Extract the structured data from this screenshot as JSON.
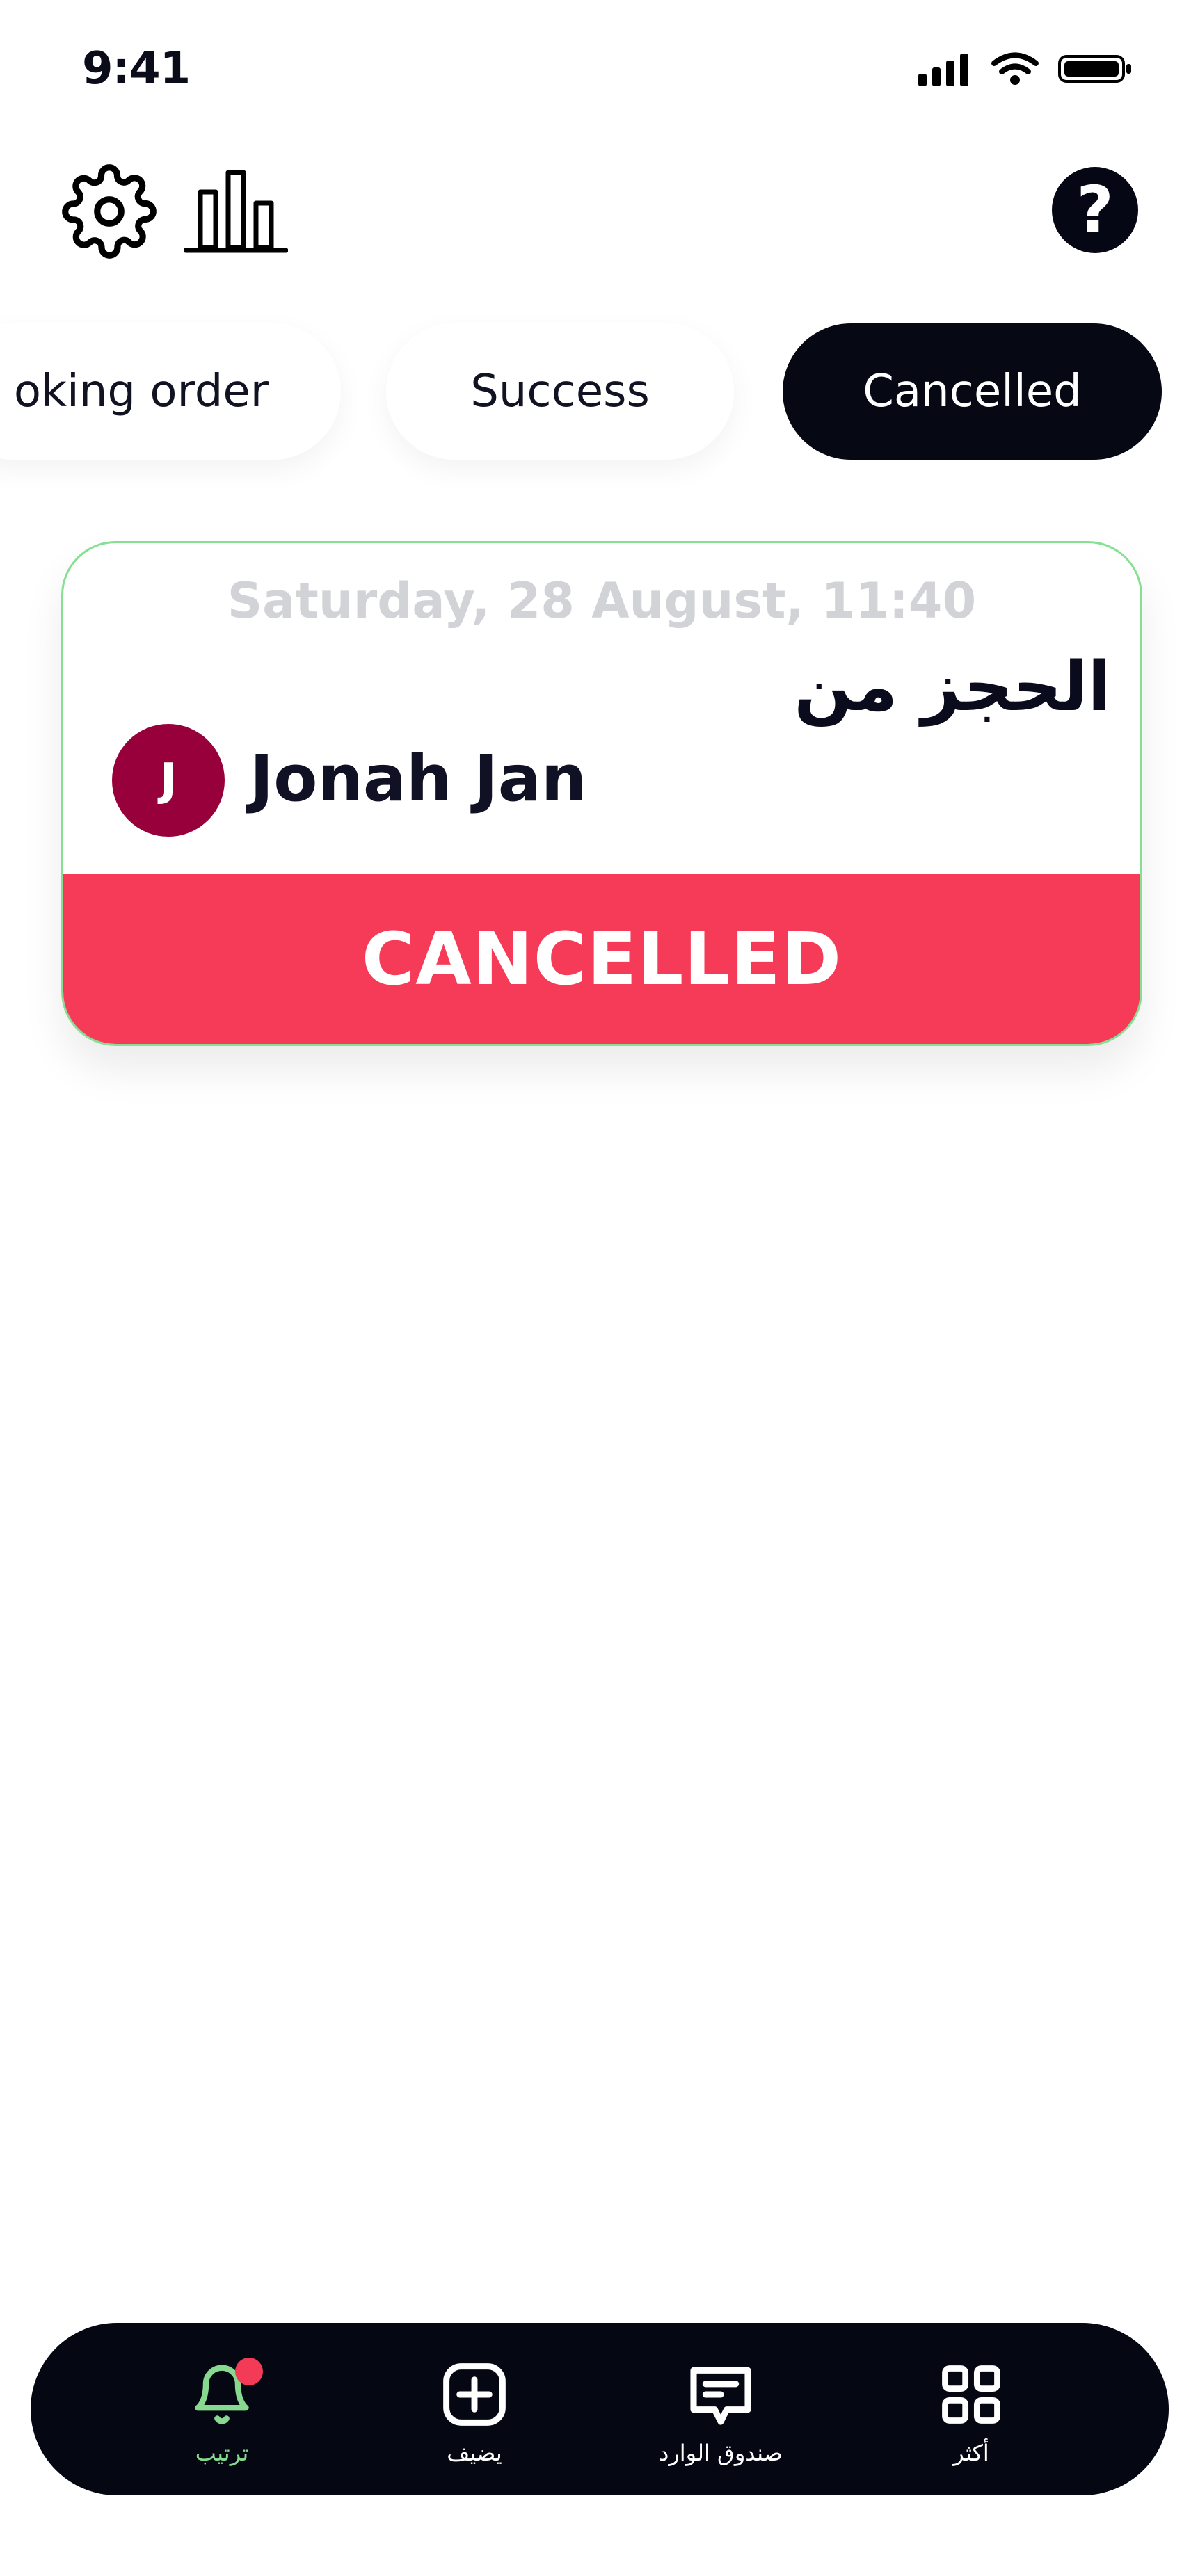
{
  "status_bar": {
    "time": "9:41"
  },
  "header": {
    "help_symbol": "?"
  },
  "tabs": [
    {
      "label": "oking order",
      "active": false
    },
    {
      "label": "Success",
      "active": false
    },
    {
      "label": "Cancelled",
      "active": true
    }
  ],
  "booking": {
    "date": "Saturday, 28 August, 11:40",
    "title": "الحجز من",
    "customer": {
      "initial": "J",
      "name": "Jonah Jan"
    },
    "status": "CANCELLED"
  },
  "bottom_nav": {
    "items": [
      {
        "label": "ترتيب",
        "icon": "bell-icon",
        "active": true,
        "has_notification": true
      },
      {
        "label": "يضيف",
        "icon": "plus-square-icon",
        "active": false
      },
      {
        "label": "صندوق الوارد",
        "icon": "message-icon",
        "active": false
      },
      {
        "label": "أكثر",
        "icon": "grid-icon",
        "active": false
      }
    ]
  },
  "colors": {
    "primary_dark": "#060913",
    "cancelled_red": "#f53b57",
    "success_green": "#87df93",
    "avatar_maroon": "#97003a",
    "notification_red": "#f33b58"
  }
}
